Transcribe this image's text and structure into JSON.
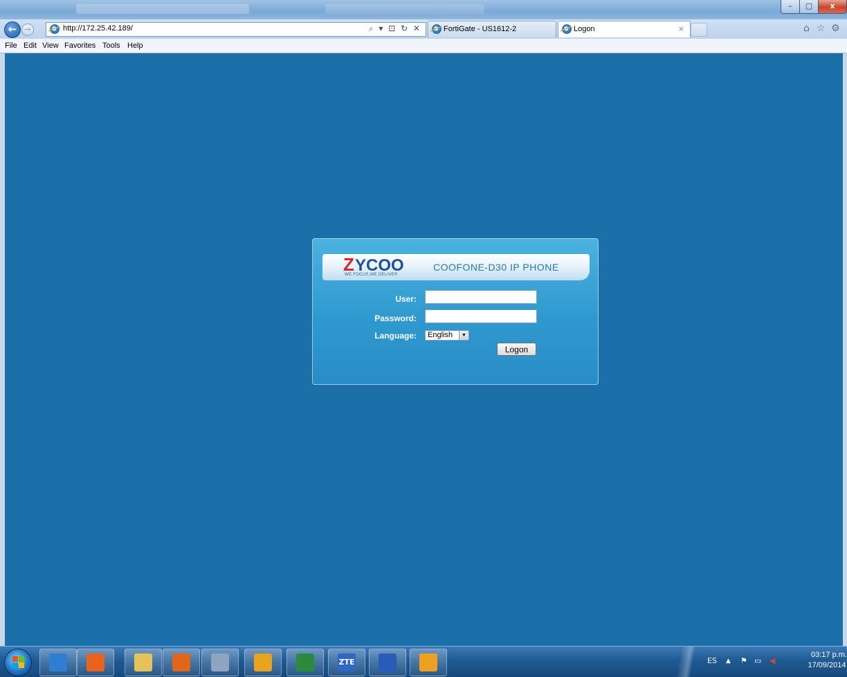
{
  "browser": {
    "address": "http://172.25.42.189/",
    "address_tools": "⌕ ▾ ⊡ ↻ ✕",
    "tabs": [
      {
        "label": "FortiGate - US1612-2",
        "active": false
      },
      {
        "label": "Logon",
        "active": true
      }
    ],
    "tab_close": "×",
    "window_buttons": {
      "minimize": "–",
      "maximize": "▢",
      "close": "x"
    },
    "toolbar_icons": [
      "home-icon",
      "favorites-star-icon",
      "tools-gear-icon"
    ]
  },
  "menu": [
    "File",
    "Edit",
    "View",
    "Favorites",
    "Tools",
    "Help"
  ],
  "login": {
    "brand": "ZYCOO",
    "tagline": "WE FOCUS,WE DELIVER",
    "product": "COOFONE-D30  IP PHONE",
    "user_label": "User:",
    "password_label": "Password:",
    "language_label": "Language:",
    "language_value": "English",
    "logon_button": "Logon"
  },
  "taskbar": {
    "apps": [
      {
        "name": "internet-explorer",
        "color": "#2e7fd3"
      },
      {
        "name": "media-player",
        "color": "#e8641b"
      },
      {
        "name": "file-explorer",
        "color": "#e6c35a"
      },
      {
        "name": "firefox",
        "color": "#e0661a"
      },
      {
        "name": "calculator",
        "color": "#8ea4bf"
      },
      {
        "name": "outlook",
        "color": "#e9a21b"
      },
      {
        "name": "excel",
        "color": "#2b8a3e"
      },
      {
        "name": "zte",
        "label": "ZTE",
        "color": "#2f66c0"
      },
      {
        "name": "word",
        "color": "#2b5bb8"
      },
      {
        "name": "app-flame",
        "color": "#f0a020"
      }
    ],
    "tray_lang": "ES",
    "tray_icons": [
      "▲",
      "⚑",
      "▭",
      "🔇"
    ],
    "time": "03:17 p.m.",
    "date": "17/09/2014"
  }
}
